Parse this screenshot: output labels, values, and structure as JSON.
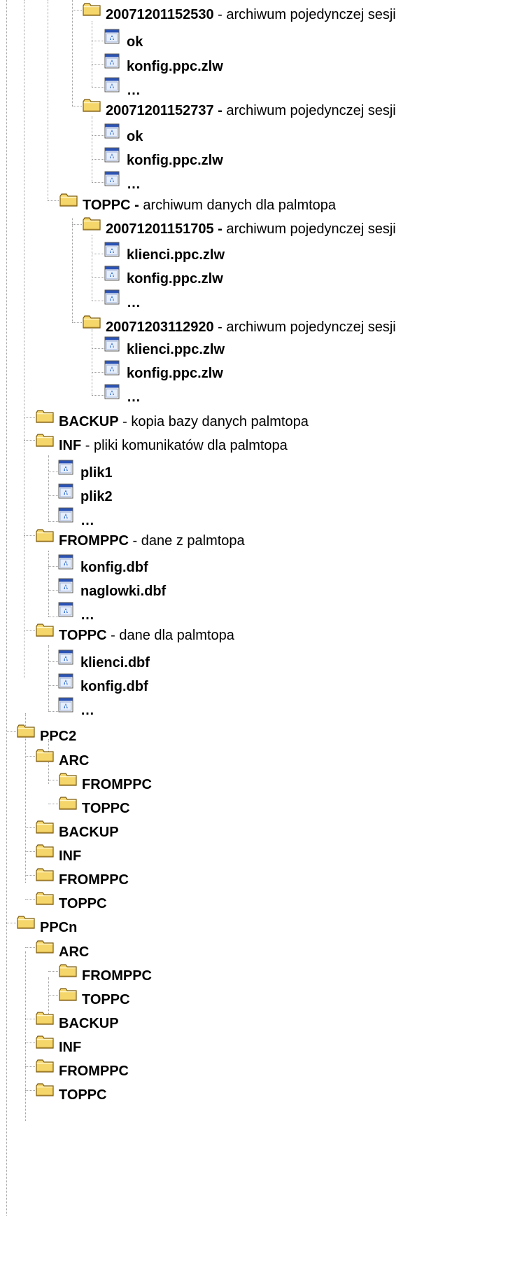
{
  "tree": {
    "nodes": [
      {
        "id": "n1",
        "type": "folder",
        "name": "20071201152530",
        "desc": " - archiwum pojedynczej sesji"
      },
      {
        "id": "n2",
        "type": "doc",
        "name": "ok",
        "desc": ""
      },
      {
        "id": "n3",
        "type": "doc",
        "name": "konfig.ppc.zlw",
        "desc": ""
      },
      {
        "id": "n4",
        "type": "doc",
        "name": "…",
        "desc": ""
      },
      {
        "id": "n5",
        "type": "folder",
        "name": "20071201152737 -",
        "desc": " archiwum pojedynczej sesji"
      },
      {
        "id": "n6",
        "type": "doc",
        "name": "ok",
        "desc": ""
      },
      {
        "id": "n7",
        "type": "doc",
        "name": "konfig.ppc.zlw",
        "desc": ""
      },
      {
        "id": "n8",
        "type": "doc",
        "name": "…",
        "desc": ""
      },
      {
        "id": "n9",
        "type": "folder",
        "name": "TOPPC -",
        "desc": " archiwum danych dla palmtopa"
      },
      {
        "id": "n10",
        "type": "folder",
        "name": "20071201151705 -",
        "desc": " archiwum pojedynczej sesji"
      },
      {
        "id": "n11",
        "type": "doc",
        "name": "klienci.ppc.zlw",
        "desc": ""
      },
      {
        "id": "n12",
        "type": "doc",
        "name": "konfig.ppc.zlw",
        "desc": ""
      },
      {
        "id": "n13",
        "type": "doc",
        "name": "…",
        "desc": ""
      },
      {
        "id": "n14",
        "type": "folder",
        "name": "20071203112920",
        "desc": " - archiwum pojedynczej sesji"
      },
      {
        "id": "n15",
        "type": "doc",
        "name": "klienci.ppc.zlw",
        "desc": ""
      },
      {
        "id": "n16",
        "type": "doc",
        "name": "konfig.ppc.zlw",
        "desc": ""
      },
      {
        "id": "n17",
        "type": "doc",
        "name": "…",
        "desc": ""
      },
      {
        "id": "n18",
        "type": "folder",
        "name": "BACKUP",
        "desc": " - kopia bazy danych palmtopa"
      },
      {
        "id": "n19",
        "type": "folder",
        "name": "INF",
        "desc": " - pliki komunikatów dla palmtopa"
      },
      {
        "id": "n20",
        "type": "doc",
        "name": "plik1",
        "desc": ""
      },
      {
        "id": "n21",
        "type": "doc",
        "name": "plik2",
        "desc": ""
      },
      {
        "id": "n22",
        "type": "doc",
        "name": "…",
        "desc": ""
      },
      {
        "id": "n23",
        "type": "folder",
        "name": "FROMPPC",
        "desc": " - dane z palmtopa"
      },
      {
        "id": "n24",
        "type": "doc",
        "name": "konfig.dbf",
        "desc": ""
      },
      {
        "id": "n25",
        "type": "doc",
        "name": "naglowki.dbf",
        "desc": ""
      },
      {
        "id": "n26",
        "type": "doc",
        "name": "…",
        "desc": ""
      },
      {
        "id": "n27",
        "type": "folder",
        "name": "TOPPC",
        "desc": " - dane dla palmtopa"
      },
      {
        "id": "n28",
        "type": "doc",
        "name": "klienci.dbf",
        "desc": ""
      },
      {
        "id": "n29",
        "type": "doc",
        "name": "konfig.dbf",
        "desc": ""
      },
      {
        "id": "n30",
        "type": "doc",
        "name": "…",
        "desc": ""
      },
      {
        "id": "n31",
        "type": "folder",
        "name": "PPC2",
        "desc": ""
      },
      {
        "id": "n32",
        "type": "folder",
        "name": "ARC",
        "desc": ""
      },
      {
        "id": "n33",
        "type": "folder",
        "name": "FROMPPC",
        "desc": ""
      },
      {
        "id": "n34",
        "type": "folder",
        "name": "TOPPC",
        "desc": ""
      },
      {
        "id": "n35",
        "type": "folder",
        "name": "BACKUP",
        "desc": ""
      },
      {
        "id": "n36",
        "type": "folder",
        "name": "INF",
        "desc": ""
      },
      {
        "id": "n37",
        "type": "folder",
        "name": "FROMPPC",
        "desc": ""
      },
      {
        "id": "n38",
        "type": "folder",
        "name": "TOPPC",
        "desc": ""
      },
      {
        "id": "n39",
        "type": "folder",
        "name": "PPCn",
        "desc": ""
      },
      {
        "id": "n40",
        "type": "folder",
        "name": "ARC",
        "desc": ""
      },
      {
        "id": "n41",
        "type": "folder",
        "name": "FROMPPC",
        "desc": ""
      },
      {
        "id": "n42",
        "type": "folder",
        "name": "TOPPC",
        "desc": ""
      },
      {
        "id": "n43",
        "type": "folder",
        "name": "BACKUP",
        "desc": ""
      },
      {
        "id": "n44",
        "type": "folder",
        "name": "INF",
        "desc": ""
      },
      {
        "id": "n45",
        "type": "folder",
        "name": "FROMPPC",
        "desc": ""
      },
      {
        "id": "n46",
        "type": "folder",
        "name": "TOPPC",
        "desc": ""
      }
    ]
  },
  "icons": {
    "folder": "folder-icon",
    "doc": "document-icon"
  },
  "colors": {
    "folder_fill": "#f5d66b",
    "folder_stroke": "#7a5a10",
    "doc_blue": "#2b53b5",
    "guide_line": "#a0a0a0"
  }
}
